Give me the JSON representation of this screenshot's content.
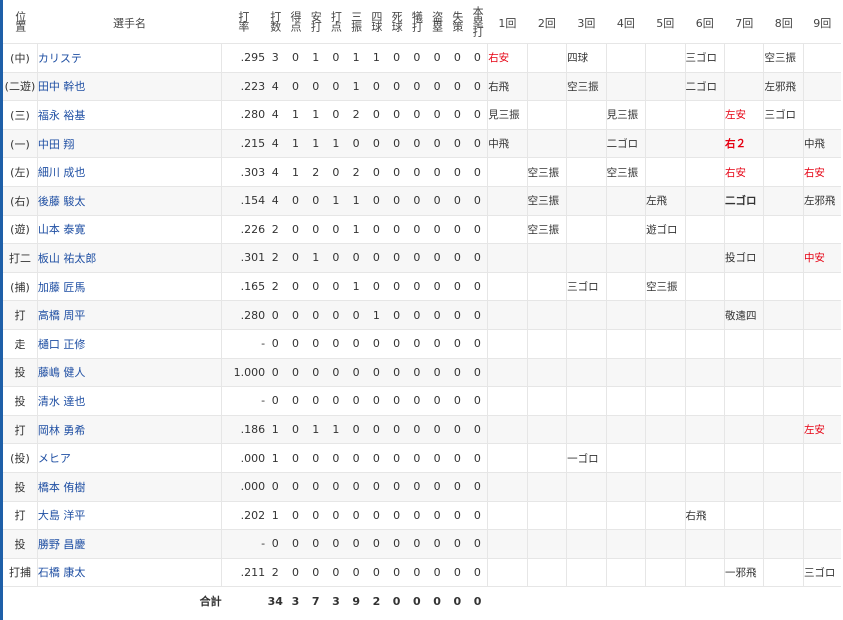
{
  "headers": {
    "position": "位置",
    "player": "選手名",
    "stats": [
      "打率",
      "打数",
      "得点",
      "安打",
      "打点",
      "三振",
      "四球",
      "死球",
      "犠打",
      "盗塁",
      "失策",
      "本塁打"
    ],
    "innings": [
      "1回",
      "2回",
      "3回",
      "4回",
      "5回",
      "6回",
      "7回",
      "8回",
      "9回"
    ]
  },
  "players": [
    {
      "pos": "(中)",
      "name": "カリステ",
      "avg": ".295",
      "stats": [
        "3",
        "0",
        "1",
        "0",
        "1",
        "1",
        "0",
        "0",
        "0",
        "0",
        "0"
      ],
      "innings": [
        {
          "t": "右安",
          "hit": true
        },
        {
          "t": ""
        },
        {
          "t": "四球"
        },
        {
          "t": ""
        },
        {
          "t": ""
        },
        {
          "t": "三ゴロ"
        },
        {
          "t": ""
        },
        {
          "t": "空三振"
        },
        {
          "t": ""
        }
      ]
    },
    {
      "pos": "(二遊)",
      "name": "田中 幹也",
      "avg": ".223",
      "stats": [
        "4",
        "0",
        "0",
        "0",
        "1",
        "0",
        "0",
        "0",
        "0",
        "0",
        "0"
      ],
      "innings": [
        {
          "t": "右飛"
        },
        {
          "t": ""
        },
        {
          "t": "空三振"
        },
        {
          "t": ""
        },
        {
          "t": ""
        },
        {
          "t": "二ゴロ"
        },
        {
          "t": ""
        },
        {
          "t": "左邪飛"
        },
        {
          "t": ""
        }
      ]
    },
    {
      "pos": "(三)",
      "name": "福永 裕基",
      "avg": ".280",
      "stats": [
        "4",
        "1",
        "1",
        "0",
        "2",
        "0",
        "0",
        "0",
        "0",
        "0",
        "0"
      ],
      "innings": [
        {
          "t": "見三振"
        },
        {
          "t": ""
        },
        {
          "t": ""
        },
        {
          "t": "見三振"
        },
        {
          "t": ""
        },
        {
          "t": ""
        },
        {
          "t": "左安",
          "hit": true
        },
        {
          "t": "三ゴロ"
        },
        {
          "t": ""
        }
      ]
    },
    {
      "pos": "(一)",
      "name": "中田 翔",
      "avg": ".215",
      "stats": [
        "4",
        "1",
        "1",
        "1",
        "0",
        "0",
        "0",
        "0",
        "0",
        "0",
        "0"
      ],
      "innings": [
        {
          "t": "中飛"
        },
        {
          "t": ""
        },
        {
          "t": ""
        },
        {
          "t": "二ゴロ"
        },
        {
          "t": ""
        },
        {
          "t": ""
        },
        {
          "t": "右２",
          "hit": true,
          "bold": true
        },
        {
          "t": ""
        },
        {
          "t": "中飛"
        }
      ]
    },
    {
      "pos": "(左)",
      "name": "細川 成也",
      "avg": ".303",
      "stats": [
        "4",
        "1",
        "2",
        "0",
        "2",
        "0",
        "0",
        "0",
        "0",
        "0",
        "0"
      ],
      "innings": [
        {
          "t": ""
        },
        {
          "t": "空三振"
        },
        {
          "t": ""
        },
        {
          "t": "空三振"
        },
        {
          "t": ""
        },
        {
          "t": ""
        },
        {
          "t": "右安",
          "hit": true
        },
        {
          "t": ""
        },
        {
          "t": "右安",
          "hit": true
        }
      ]
    },
    {
      "pos": "(右)",
      "name": "後藤 駿太",
      "avg": ".154",
      "stats": [
        "4",
        "0",
        "0",
        "1",
        "1",
        "0",
        "0",
        "0",
        "0",
        "0",
        "0"
      ],
      "innings": [
        {
          "t": ""
        },
        {
          "t": "空三振"
        },
        {
          "t": ""
        },
        {
          "t": ""
        },
        {
          "t": "左飛"
        },
        {
          "t": ""
        },
        {
          "t": "二ゴロ",
          "bold": true
        },
        {
          "t": ""
        },
        {
          "t": "左邪飛"
        }
      ]
    },
    {
      "pos": "(遊)",
      "name": "山本 泰寛",
      "avg": ".226",
      "stats": [
        "2",
        "0",
        "0",
        "0",
        "1",
        "0",
        "0",
        "0",
        "0",
        "0",
        "0"
      ],
      "innings": [
        {
          "t": ""
        },
        {
          "t": "空三振"
        },
        {
          "t": ""
        },
        {
          "t": ""
        },
        {
          "t": "遊ゴロ"
        },
        {
          "t": ""
        },
        {
          "t": ""
        },
        {
          "t": ""
        },
        {
          "t": ""
        }
      ]
    },
    {
      "pos": "打二",
      "name": "板山 祐太郎",
      "avg": ".301",
      "stats": [
        "2",
        "0",
        "1",
        "0",
        "0",
        "0",
        "0",
        "0",
        "0",
        "0",
        "0"
      ],
      "innings": [
        {
          "t": ""
        },
        {
          "t": ""
        },
        {
          "t": ""
        },
        {
          "t": ""
        },
        {
          "t": ""
        },
        {
          "t": ""
        },
        {
          "t": "投ゴロ"
        },
        {
          "t": ""
        },
        {
          "t": "中安",
          "hit": true
        }
      ]
    },
    {
      "pos": "(捕)",
      "name": "加藤 匠馬",
      "avg": ".165",
      "stats": [
        "2",
        "0",
        "0",
        "0",
        "1",
        "0",
        "0",
        "0",
        "0",
        "0",
        "0"
      ],
      "innings": [
        {
          "t": ""
        },
        {
          "t": ""
        },
        {
          "t": "三ゴロ"
        },
        {
          "t": ""
        },
        {
          "t": "空三振"
        },
        {
          "t": ""
        },
        {
          "t": ""
        },
        {
          "t": ""
        },
        {
          "t": ""
        }
      ]
    },
    {
      "pos": "打",
      "name": "高橋 周平",
      "avg": ".280",
      "stats": [
        "0",
        "0",
        "0",
        "0",
        "0",
        "1",
        "0",
        "0",
        "0",
        "0",
        "0"
      ],
      "innings": [
        {
          "t": ""
        },
        {
          "t": ""
        },
        {
          "t": ""
        },
        {
          "t": ""
        },
        {
          "t": ""
        },
        {
          "t": ""
        },
        {
          "t": "敬遠四"
        },
        {
          "t": ""
        },
        {
          "t": ""
        }
      ]
    },
    {
      "pos": "走",
      "name": "樋口 正修",
      "avg": "-",
      "stats": [
        "0",
        "0",
        "0",
        "0",
        "0",
        "0",
        "0",
        "0",
        "0",
        "0",
        "0"
      ],
      "innings": [
        {
          "t": ""
        },
        {
          "t": ""
        },
        {
          "t": ""
        },
        {
          "t": ""
        },
        {
          "t": ""
        },
        {
          "t": ""
        },
        {
          "t": ""
        },
        {
          "t": ""
        },
        {
          "t": ""
        }
      ]
    },
    {
      "pos": "投",
      "name": "藤嶋 健人",
      "avg": "1.000",
      "stats": [
        "0",
        "0",
        "0",
        "0",
        "0",
        "0",
        "0",
        "0",
        "0",
        "0",
        "0"
      ],
      "innings": [
        {
          "t": ""
        },
        {
          "t": ""
        },
        {
          "t": ""
        },
        {
          "t": ""
        },
        {
          "t": ""
        },
        {
          "t": ""
        },
        {
          "t": ""
        },
        {
          "t": ""
        },
        {
          "t": ""
        }
      ]
    },
    {
      "pos": "投",
      "name": "清水 達也",
      "avg": "-",
      "stats": [
        "0",
        "0",
        "0",
        "0",
        "0",
        "0",
        "0",
        "0",
        "0",
        "0",
        "0"
      ],
      "innings": [
        {
          "t": ""
        },
        {
          "t": ""
        },
        {
          "t": ""
        },
        {
          "t": ""
        },
        {
          "t": ""
        },
        {
          "t": ""
        },
        {
          "t": ""
        },
        {
          "t": ""
        },
        {
          "t": ""
        }
      ]
    },
    {
      "pos": "打",
      "name": "岡林 勇希",
      "avg": ".186",
      "stats": [
        "1",
        "0",
        "1",
        "1",
        "0",
        "0",
        "0",
        "0",
        "0",
        "0",
        "0"
      ],
      "innings": [
        {
          "t": ""
        },
        {
          "t": ""
        },
        {
          "t": ""
        },
        {
          "t": ""
        },
        {
          "t": ""
        },
        {
          "t": ""
        },
        {
          "t": ""
        },
        {
          "t": ""
        },
        {
          "t": "左安",
          "hit": true
        }
      ]
    },
    {
      "pos": "(投)",
      "name": "メヒア",
      "avg": ".000",
      "stats": [
        "1",
        "0",
        "0",
        "0",
        "0",
        "0",
        "0",
        "0",
        "0",
        "0",
        "0"
      ],
      "innings": [
        {
          "t": ""
        },
        {
          "t": ""
        },
        {
          "t": "一ゴロ"
        },
        {
          "t": ""
        },
        {
          "t": ""
        },
        {
          "t": ""
        },
        {
          "t": ""
        },
        {
          "t": ""
        },
        {
          "t": ""
        }
      ]
    },
    {
      "pos": "投",
      "name": "橋本 侑樹",
      "avg": ".000",
      "stats": [
        "0",
        "0",
        "0",
        "0",
        "0",
        "0",
        "0",
        "0",
        "0",
        "0",
        "0"
      ],
      "innings": [
        {
          "t": ""
        },
        {
          "t": ""
        },
        {
          "t": ""
        },
        {
          "t": ""
        },
        {
          "t": ""
        },
        {
          "t": ""
        },
        {
          "t": ""
        },
        {
          "t": ""
        },
        {
          "t": ""
        }
      ]
    },
    {
      "pos": "打",
      "name": "大島 洋平",
      "avg": ".202",
      "stats": [
        "1",
        "0",
        "0",
        "0",
        "0",
        "0",
        "0",
        "0",
        "0",
        "0",
        "0"
      ],
      "innings": [
        {
          "t": ""
        },
        {
          "t": ""
        },
        {
          "t": ""
        },
        {
          "t": ""
        },
        {
          "t": ""
        },
        {
          "t": "右飛"
        },
        {
          "t": ""
        },
        {
          "t": ""
        },
        {
          "t": ""
        }
      ]
    },
    {
      "pos": "投",
      "name": "勝野 昌慶",
      "avg": "-",
      "stats": [
        "0",
        "0",
        "0",
        "0",
        "0",
        "0",
        "0",
        "0",
        "0",
        "0",
        "0"
      ],
      "innings": [
        {
          "t": ""
        },
        {
          "t": ""
        },
        {
          "t": ""
        },
        {
          "t": ""
        },
        {
          "t": ""
        },
        {
          "t": ""
        },
        {
          "t": ""
        },
        {
          "t": ""
        },
        {
          "t": ""
        }
      ]
    },
    {
      "pos": "打捕",
      "name": "石橋 康太",
      "avg": ".211",
      "stats": [
        "2",
        "0",
        "0",
        "0",
        "0",
        "0",
        "0",
        "0",
        "0",
        "0",
        "0"
      ],
      "innings": [
        {
          "t": ""
        },
        {
          "t": ""
        },
        {
          "t": ""
        },
        {
          "t": ""
        },
        {
          "t": ""
        },
        {
          "t": ""
        },
        {
          "t": "一邪飛"
        },
        {
          "t": ""
        },
        {
          "t": "三ゴロ"
        }
      ]
    }
  ],
  "total": {
    "label": "合計",
    "stats": [
      "34",
      "3",
      "7",
      "3",
      "9",
      "2",
      "0",
      "0",
      "0",
      "0",
      "0"
    ]
  },
  "colors": {
    "accent": "#1e5fa8",
    "name_link": "#1f4fa3",
    "hit": "#e60012",
    "row_stripe": "#f7f7f7"
  }
}
